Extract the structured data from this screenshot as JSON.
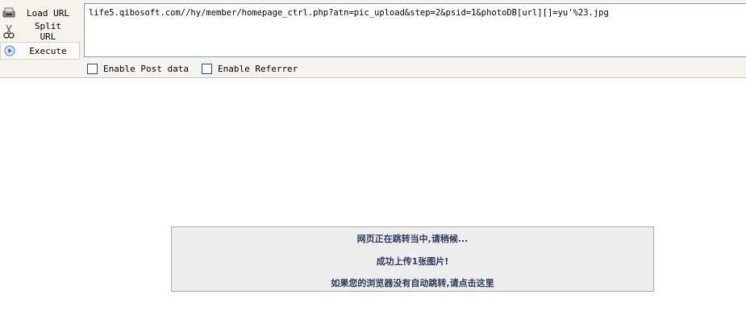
{
  "toolbar": {
    "load_label": "Load URL",
    "split_label": "Split URL",
    "execute_label": "Execute",
    "url_value": "life5.qibosoft.com//hy/member/homepage_ctrl.php?atn=pic_upload&step=2&psid=1&photoDB[url][]=yu'%23.jpg",
    "post_label": "Enable Post data",
    "referrer_label": "Enable Referrer",
    "icons": [
      "load-url-icon",
      "split-url-icon",
      "execute-icon"
    ]
  },
  "message": {
    "line1": "网页正在跳转当中,请稍候...",
    "line2": "成功上传1张图片!",
    "line3": "如果您的浏览器没有自动跳转,请点击这里"
  }
}
